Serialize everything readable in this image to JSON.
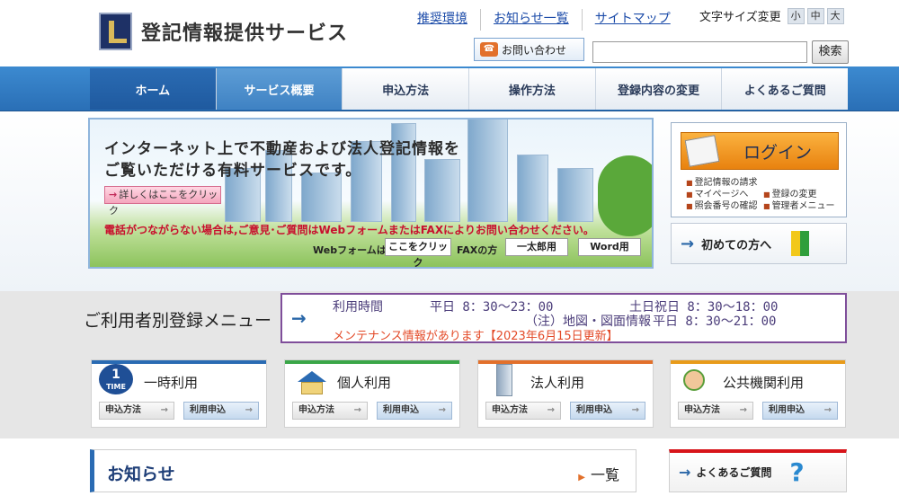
{
  "header": {
    "site_title": "登記情報提供サービス",
    "top_links": [
      "推奨環境",
      "お知らせ一覧",
      "サイトマップ"
    ],
    "font_size_label": "文字サイズ変更",
    "font_size_options": [
      "小",
      "中",
      "大"
    ],
    "contact_label": "お問い合わせ",
    "search_placeholder": "",
    "search_button": "検索"
  },
  "nav": {
    "items": [
      "ホーム",
      "サービス概要",
      "申込方法",
      "操作方法",
      "登録内容の変更",
      "よくあるご質問"
    ]
  },
  "banner": {
    "title_line1": "インターネット上で不動産および法人登記情報を",
    "title_line2": "ご覧いただける有料サービスです。",
    "detail_button": "詳しくはここをクリック",
    "notice": "電話がつながらない場合は,ご意見･ご質問はWebフォームまたはFAXによりお問い合わせください。",
    "web_form_label": "Webフォームは",
    "web_form_button": "ここをクリック",
    "fax_label": "FAXの方",
    "fax_ichitaro": "一太郎用",
    "fax_word": "Word用"
  },
  "login": {
    "button": "ログイン",
    "links": [
      "登記情報の請求",
      "マイページへ",
      "登録の変更",
      "照会番号の確認",
      "管理者メニュー"
    ],
    "first_time": "初めての方へ"
  },
  "registration": {
    "title": "ご利用者別登録メニュー",
    "hours_label": "利用時間",
    "weekday": "平日 8：30～23：00",
    "holiday": "土日祝日 8：30～18：00",
    "map_note": "（注）地図・図面情報",
    "map_hours": "平日 8：30～21：00",
    "maintenance": "メンテナンス情報があります【2023年6月15日更新】",
    "cards": [
      {
        "title": "一時利用",
        "apply": "申込方法",
        "use": "利用申込",
        "icon_text": "1",
        "icon_sub": "TIME"
      },
      {
        "title": "個人利用",
        "apply": "申込方法",
        "use": "利用申込"
      },
      {
        "title": "法人利用",
        "apply": "申込方法",
        "use": "利用申込"
      },
      {
        "title": "公共機関利用",
        "apply": "申込方法",
        "use": "利用申込"
      }
    ]
  },
  "news": {
    "title": "お知らせ",
    "more": "一覧"
  },
  "faq": {
    "label": "よくあるご質問",
    "icon": "?"
  },
  "colors": {
    "nav_blue": "#2a6bb3",
    "login_orange": "#f0a02c",
    "card_bars": [
      "#2a6bb3",
      "#3aa648",
      "#e2702b",
      "#e89b1a"
    ],
    "maintenance_red": "#e34a28"
  }
}
